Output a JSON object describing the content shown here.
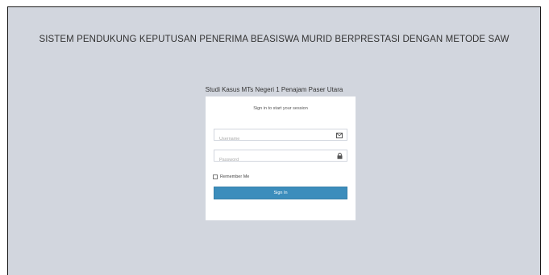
{
  "header": {
    "title": "SISTEM PENDUKUNG KEPUTUSAN PENERIMA BEASISWA MURID BERPRESTASI DENGAN METODE SAW"
  },
  "login": {
    "case_study": "Studi Kasus MTs Negeri 1 Penajam Paser Utara",
    "box_message": "Sign in to start your session",
    "username_placeholder": "Username",
    "username_icon": "envelope-icon",
    "password_placeholder": "Password",
    "password_icon": "lock-icon",
    "remember_label": "Remember Me",
    "signin_label": "Sign In",
    "accent_color": "#3c8dbc",
    "background_color": "#d2d6de"
  }
}
